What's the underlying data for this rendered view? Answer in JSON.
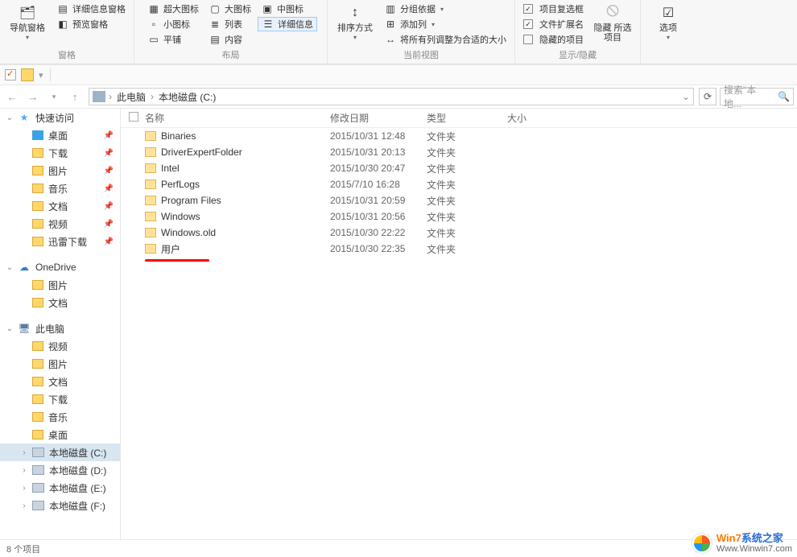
{
  "ribbon": {
    "nav": {
      "nav_pane": "导航窗格",
      "detail_pane": "详细信息窗格",
      "preview_pane": "预览窗格",
      "group": "窗格"
    },
    "layout": {
      "extra_large": "超大图标",
      "large": "大图标",
      "medium": "中图标",
      "small": "小图标",
      "list": "列表",
      "details": "详细信息",
      "tiles": "平铺",
      "content": "内容",
      "group": "布局"
    },
    "view": {
      "sort": "排序方式",
      "group_by": "分组依据",
      "add_col": "添加列",
      "fit_cols": "将所有列调整为合适的大小",
      "group": "当前视图"
    },
    "show": {
      "checkboxes": "项目复选框",
      "extensions": "文件扩展名",
      "hidden": "隐藏的项目",
      "hide_sel": "隐藏\n所选项目",
      "group": "显示/隐藏"
    },
    "options": "选项"
  },
  "address": {
    "this_pc": "此电脑",
    "drive": "本地磁盘 (C:)",
    "search_ph": "搜索\"本地..."
  },
  "nav": {
    "quick": "快速访问",
    "quick_items": [
      "桌面",
      "下载",
      "图片",
      "音乐",
      "文档",
      "视频",
      "迅雷下载"
    ],
    "onedrive": "OneDrive",
    "od_items": [
      "图片",
      "文档"
    ],
    "this_pc": "此电脑",
    "pc_items": [
      "视频",
      "图片",
      "文档",
      "下载",
      "音乐",
      "桌面"
    ],
    "drives": [
      "本地磁盘 (C:)",
      "本地磁盘 (D:)",
      "本地磁盘 (E:)",
      "本地磁盘 (F:)"
    ]
  },
  "cols": {
    "name": "名称",
    "date": "修改日期",
    "type": "类型",
    "size": "大小"
  },
  "rows": [
    {
      "n": "Binaries",
      "d": "2015/10/31 12:48",
      "t": "文件夹"
    },
    {
      "n": "DriverExpertFolder",
      "d": "2015/10/31 20:13",
      "t": "文件夹"
    },
    {
      "n": "Intel",
      "d": "2015/10/30 20:47",
      "t": "文件夹"
    },
    {
      "n": "PerfLogs",
      "d": "2015/7/10 16:28",
      "t": "文件夹"
    },
    {
      "n": "Program Files",
      "d": "2015/10/31 20:59",
      "t": "文件夹"
    },
    {
      "n": "Windows",
      "d": "2015/10/31 20:56",
      "t": "文件夹"
    },
    {
      "n": "Windows.old",
      "d": "2015/10/30 22:22",
      "t": "文件夹"
    },
    {
      "n": "用户",
      "d": "2015/10/30 22:35",
      "t": "文件夹"
    }
  ],
  "status": "8 个项目",
  "watermark": {
    "l1a": "Win7",
    "l1b": "系统之家",
    "l2": "Www.Winwin7.com"
  }
}
